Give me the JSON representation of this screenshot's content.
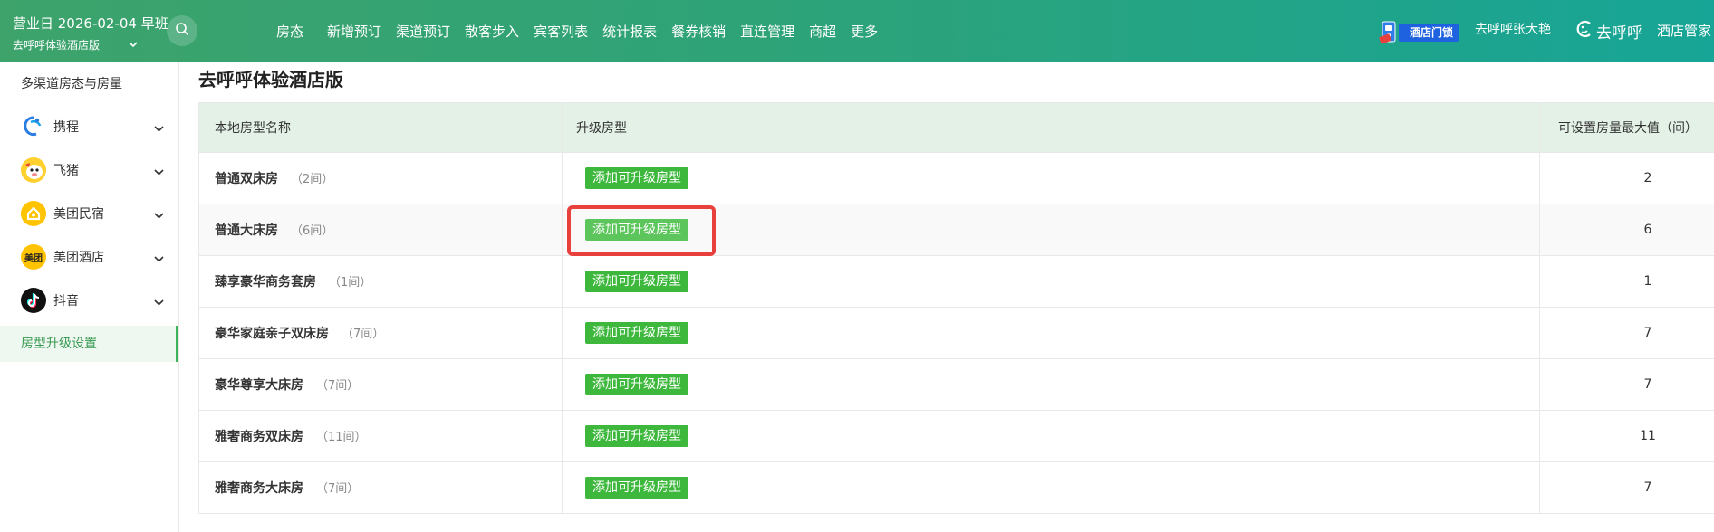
{
  "header": {
    "business_day": "营业日 2026-02-04 早班",
    "hotel_selector": "去呼呼体验酒店版",
    "nav": [
      "房态",
      "新增预订",
      "渠道预订",
      "散客步入",
      "宾客列表",
      "统计报表",
      "餐券核销",
      "直连管理",
      "商超",
      "更多"
    ],
    "lock_badge": "酒店门锁",
    "user": "去呼呼张大艳",
    "brand": "去呼呼",
    "manager": "酒店管家"
  },
  "sidebar": {
    "first_item": "多渠道房态与房量",
    "channels": [
      {
        "label": "携程",
        "icon": "ctrip-logo-icon"
      },
      {
        "label": "飞猪",
        "icon": "fliggy-logo-icon"
      },
      {
        "label": "美团民宿",
        "icon": "meituan-homestay-logo-icon"
      },
      {
        "label": "美团酒店",
        "icon": "meituan-hotel-logo-icon",
        "icon_text": "美团"
      },
      {
        "label": "抖音",
        "icon": "douyin-logo-icon"
      }
    ],
    "active_item": "房型升级设置"
  },
  "main": {
    "title": "去呼呼体验酒店版",
    "columns": [
      "本地房型名称",
      "升级房型",
      "可设置房量最大值（间）"
    ],
    "add_button_label": "添加可升级房型",
    "rows": [
      {
        "name": "普通双床房",
        "count": "（2间）",
        "max": "2"
      },
      {
        "name": "普通大床房",
        "count": "（6间）",
        "max": "6"
      },
      {
        "name": "臻享豪华商务套房",
        "count": "（1间）",
        "max": "1"
      },
      {
        "name": "豪华家庭亲子双床房",
        "count": "（7间）",
        "max": "7"
      },
      {
        "name": "豪华尊享大床房",
        "count": "（7间）",
        "max": "7"
      },
      {
        "name": "雅奢商务双床房",
        "count": "（11间）",
        "max": "11"
      },
      {
        "name": "雅奢商务大床房",
        "count": "（7间）",
        "max": "7"
      }
    ]
  },
  "colors": {
    "header_gradient_start": "#3da36b",
    "header_gradient_end": "#17a597",
    "button_green": "#3db83d",
    "table_header_bg": "#e3f1e7",
    "highlight_red": "#e8403c",
    "active_text": "#3a9a52"
  }
}
